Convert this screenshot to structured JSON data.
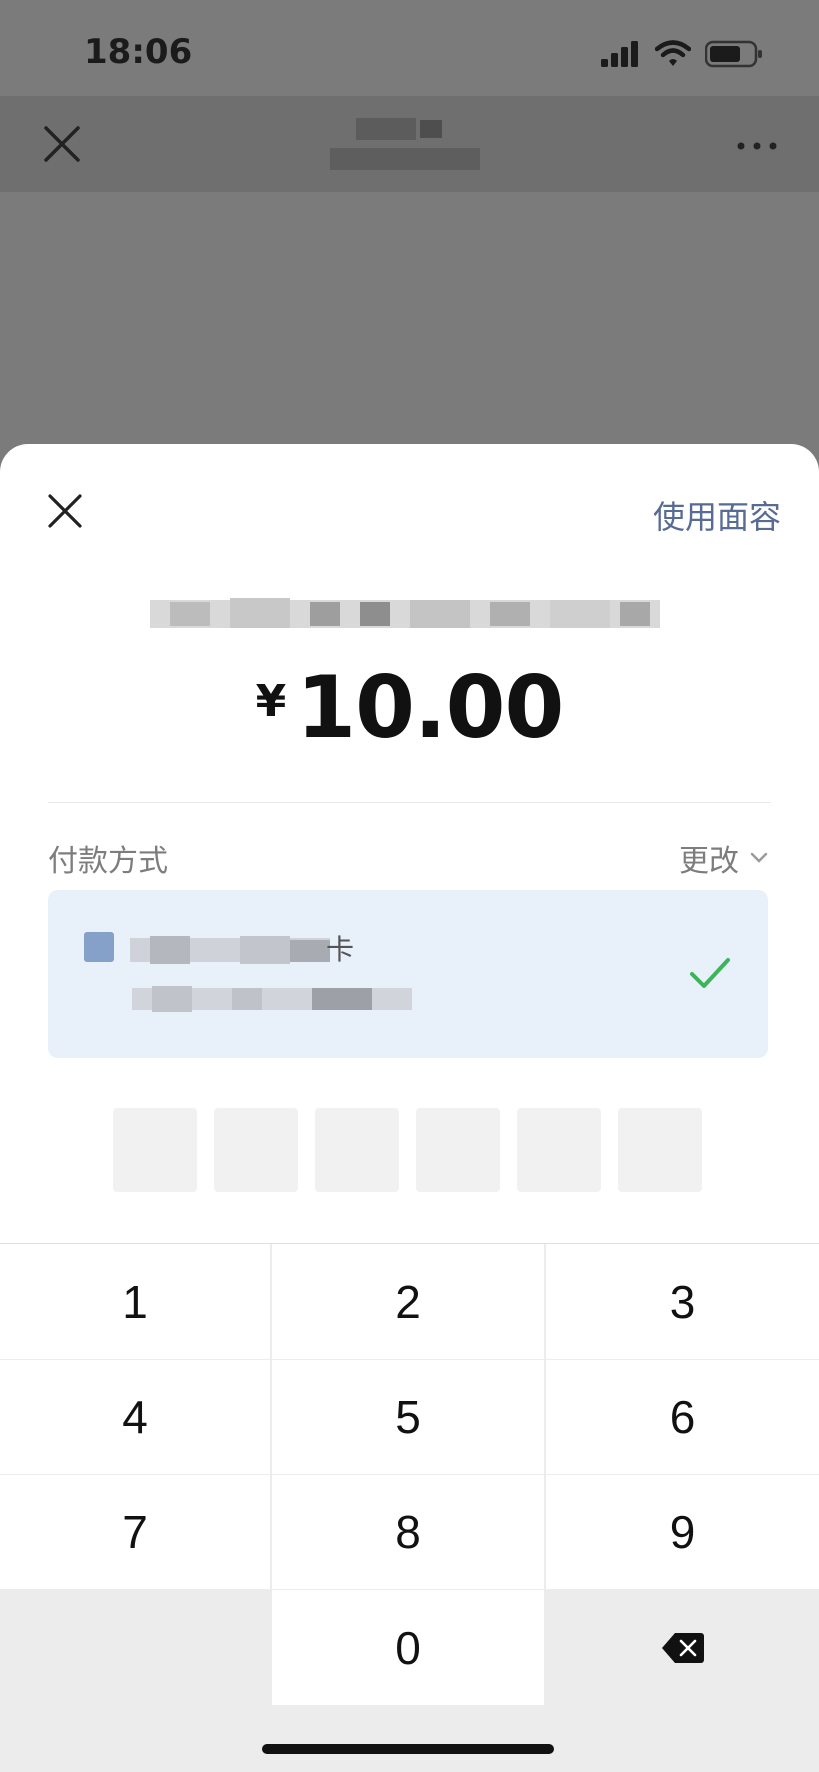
{
  "status_bar": {
    "time": "18:06",
    "icons": [
      "cellular-signal-icon",
      "wifi-icon",
      "battery-icon"
    ]
  },
  "header": {
    "icons": [
      "close-icon",
      "more-icon"
    ]
  },
  "sheet": {
    "use_face_label": "使用面容",
    "amount_currency": "¥",
    "amount_value": "10.00",
    "payment_method_label": "付款方式",
    "change_label": "更改",
    "card_text_visible_char": "卡"
  },
  "keypad": {
    "keys": [
      "1",
      "2",
      "3",
      "4",
      "5",
      "6",
      "7",
      "8",
      "9",
      "",
      "0",
      "delete"
    ]
  },
  "colors": {
    "accent_link": "#576b95",
    "check_green": "#07c160",
    "card_bg": "#e8f0fa"
  }
}
